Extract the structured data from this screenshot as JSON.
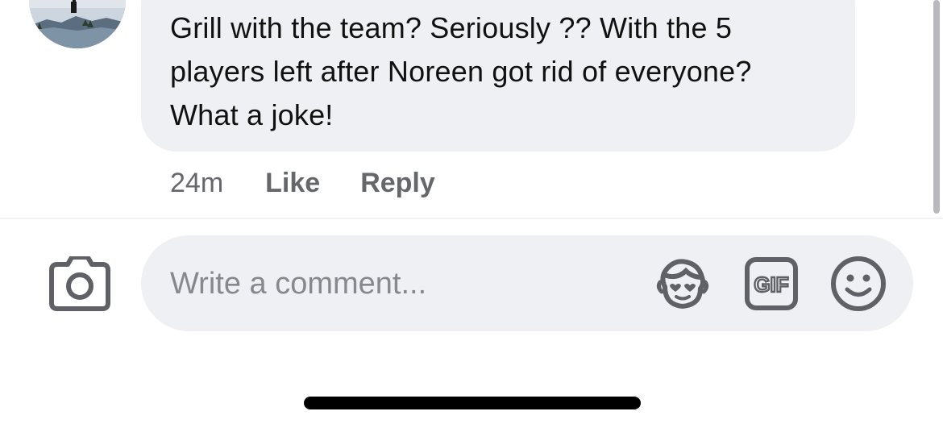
{
  "comment": {
    "text": "Grill with the team? Seriously ?? With the 5\nplayers left after Noreen got rid of everyone?\nWhat a joke!",
    "time": "24m",
    "like_label": "Like",
    "reply_label": "Reply"
  },
  "composer": {
    "placeholder": "Write a comment...",
    "value": "",
    "camera_icon": "camera-icon",
    "avatar_sticker_icon": "avatar-sticker-icon",
    "gif_icon": "gif-icon",
    "gif_label": "GIF",
    "emoji_icon": "emoji-icon"
  },
  "colors": {
    "bubble_bg": "#eff0f4",
    "text_primary": "#111111",
    "text_secondary": "#65676b",
    "icon": "#5f6166"
  }
}
